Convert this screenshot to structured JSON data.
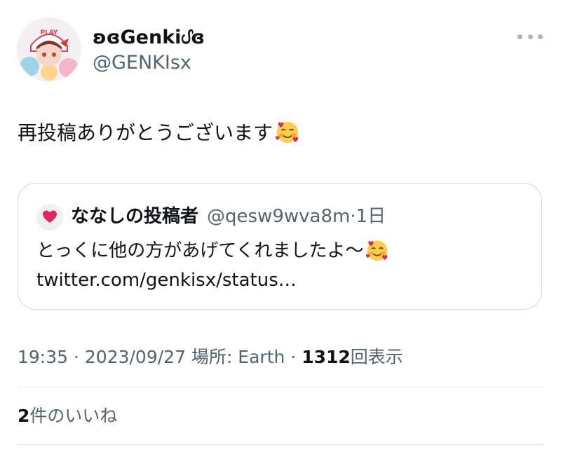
{
  "author": {
    "display_name": "ʚɞGenkiᦔɞ",
    "handle": "@GENKIsx",
    "avatar_badge": "PLAY"
  },
  "tweet": {
    "text": "再投稿ありがとうございます",
    "emoji": "smiling-face-with-hearts"
  },
  "quote": {
    "avatar_emoji": "heart-icon",
    "name": "ななしの投稿者",
    "handle": "@qesw9wva8m",
    "separator": "·",
    "time": "1日",
    "text": "とっくに他の方があげてくれましたよ〜",
    "link": "twitter.com/genkisx/status…"
  },
  "meta": {
    "time": "19:35",
    "sep1": " · ",
    "date": "2023/09/27",
    "location": " 場所: Earth",
    "sep2": " · ",
    "views": "1312",
    "views_label": "回表示"
  },
  "likes": {
    "count": "2",
    "label": "件のいいね"
  },
  "colors": {
    "text": "#0f1419",
    "secondary": "#536471",
    "border": "#cfd9de",
    "heart": "#e0245e"
  }
}
